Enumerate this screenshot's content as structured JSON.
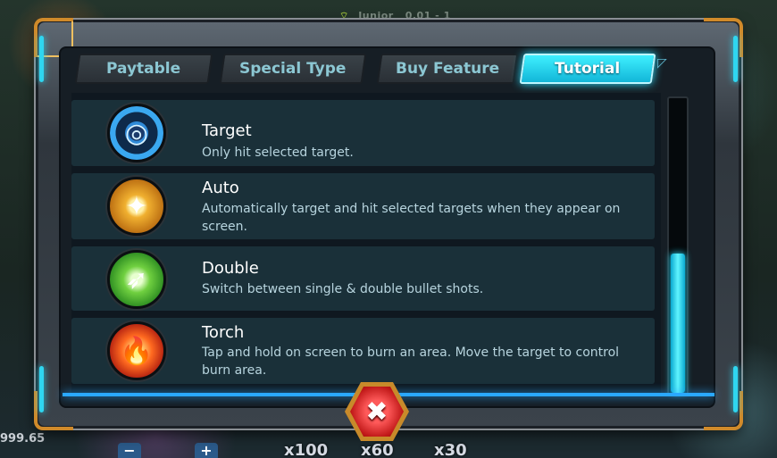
{
  "status": {
    "level": "Junior",
    "bet_range": "0.01 - 1"
  },
  "bottom_bar": {
    "balance": "999.65",
    "minus_label": "−",
    "plus_label": "+",
    "multipliers": [
      "x100",
      "x60",
      "x30"
    ]
  },
  "tabs": [
    {
      "label": "Paytable",
      "active": false
    },
    {
      "label": "Special Type",
      "active": false
    },
    {
      "label": "Buy Feature",
      "active": false
    },
    {
      "label": "Tutorial",
      "active": true
    }
  ],
  "items": [
    {
      "title": "Target",
      "desc": "Only hit selected target.",
      "icon": "target-icon",
      "glyph": "◎"
    },
    {
      "title": "Auto",
      "desc": "Automatically target and hit selected targets when they appear on screen.",
      "icon": "auto-icon",
      "glyph": "✦"
    },
    {
      "title": "Double",
      "desc": "Switch between single & double bullet shots.",
      "icon": "double-icon",
      "glyph": "➶"
    },
    {
      "title": "Torch",
      "desc": "Tap and hold on screen to burn an area. Move the target to control burn area.",
      "icon": "torch-icon",
      "glyph": "🔥"
    }
  ],
  "close_label": "✖",
  "colors": {
    "accent": "#2fd6f0",
    "frame_gold": "#d08a2a",
    "close_red": "#c01818",
    "row_bg": "#1a3039"
  }
}
